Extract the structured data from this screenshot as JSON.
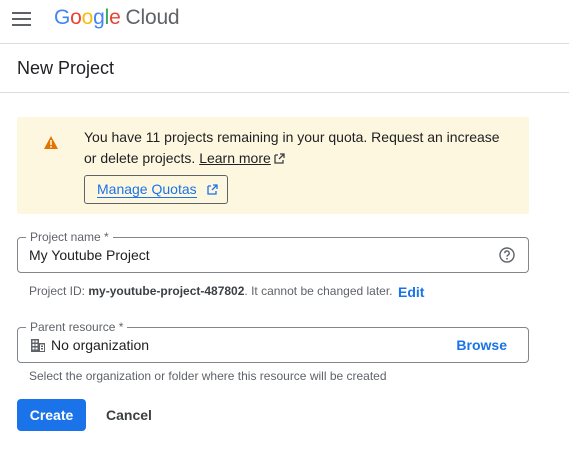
{
  "topbar": {
    "logo_letters": [
      "G",
      "o",
      "o",
      "g",
      "l",
      "e"
    ],
    "logo_product": "Cloud",
    "icons": {
      "menu": "hamburger-menu-icon"
    }
  },
  "header": {
    "title": "New Project"
  },
  "quota_banner": {
    "text": "You have 11 projects remaining in your quota. Request an increase or delete projects.",
    "learn_more_label": "Learn more",
    "manage_quotas_label": "Manage Quotas",
    "icons": {
      "warning": "warning-icon",
      "external": "external-link-icon"
    }
  },
  "project_name": {
    "label": "Project name *",
    "value": "My Youtube Project",
    "icon": "help-circle-icon"
  },
  "project_id": {
    "prefix": "Project ID: ",
    "value": "my-youtube-project-487802",
    "suffix": ". It cannot be changed later.",
    "edit_label": "Edit"
  },
  "parent_resource": {
    "label": "Parent resource *",
    "value": "No organization",
    "browse_label": "Browse",
    "hint": "Select the organization or folder where this resource will be created",
    "icon": "organization-building-icon"
  },
  "actions": {
    "create_label": "Create",
    "cancel_label": "Cancel"
  },
  "colors": {
    "primary": "#1a73e8",
    "banner_bg": "#fef7e0",
    "warning": "#e37400",
    "google_blue": "#4285f4",
    "google_red": "#ea4335",
    "google_yellow": "#fbbc04",
    "google_green": "#34a853"
  }
}
